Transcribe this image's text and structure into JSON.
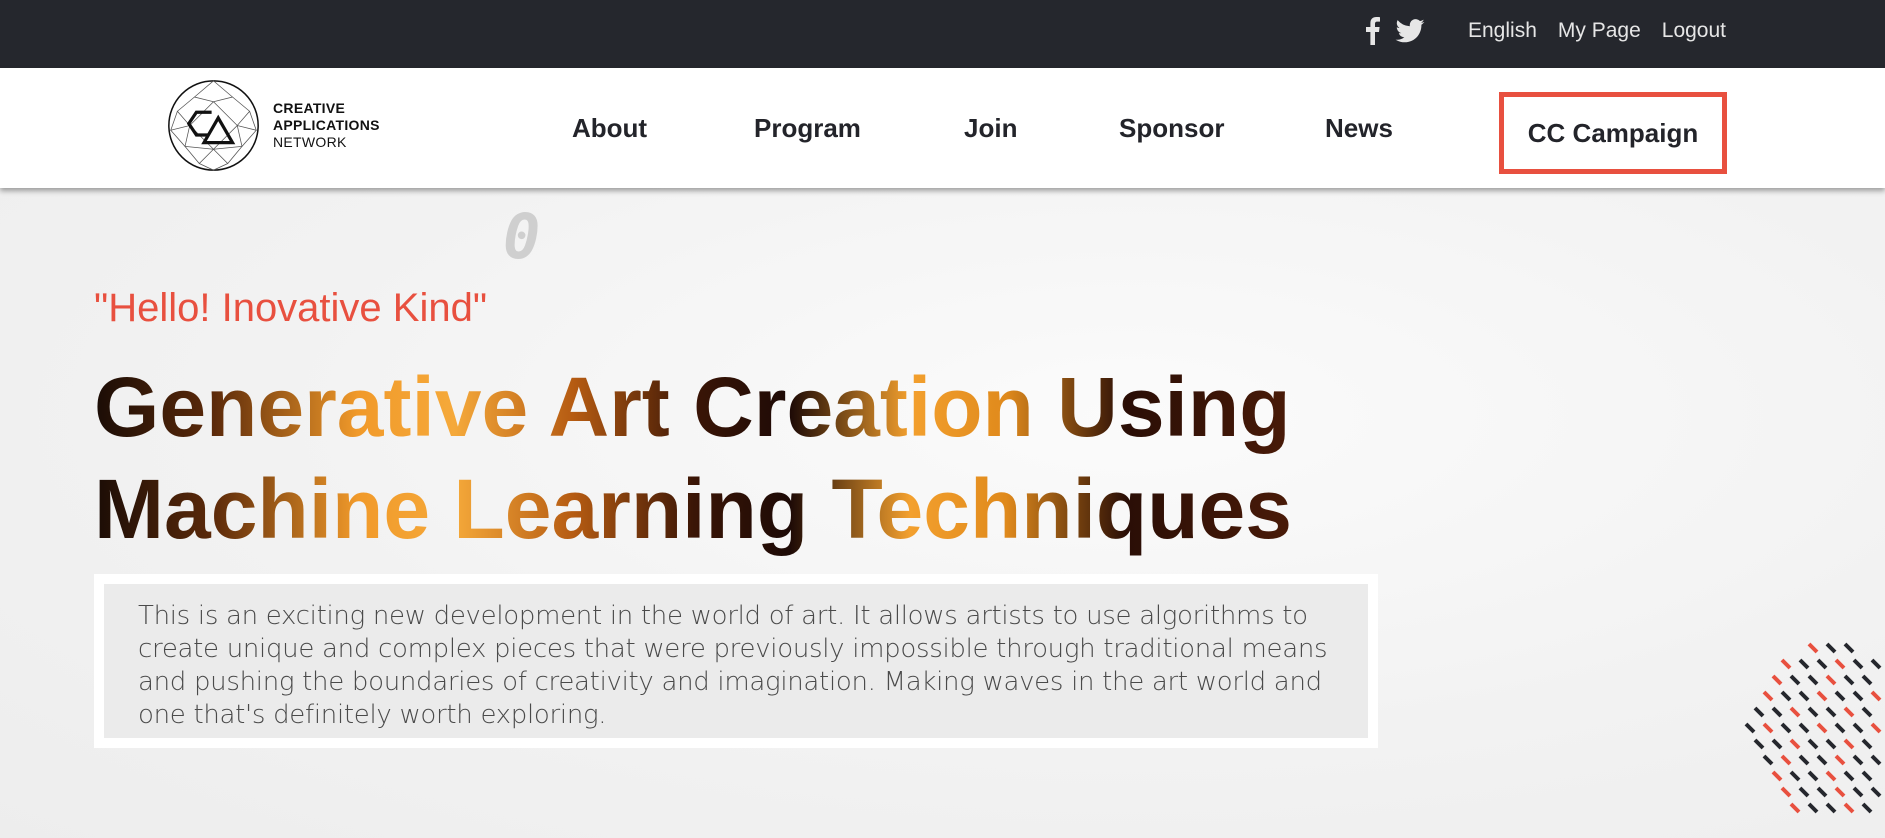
{
  "topbar": {
    "social": [
      {
        "icon": "facebook-icon"
      },
      {
        "icon": "twitter-icon"
      }
    ],
    "links": [
      "English",
      "My Page",
      "Logout"
    ]
  },
  "logo": {
    "line1": "CREATIVE",
    "line2": "APPLICATIONS",
    "line3": "NETWORK"
  },
  "nav": {
    "items": [
      "About",
      "Program",
      "Join",
      "Sponsor",
      "News"
    ],
    "cta": "CC Campaign"
  },
  "hero": {
    "greeting": "\"Hello! Inovative Kind\"",
    "headline": "Generative Art Creation Using Machine Learning Techniques",
    "description": "This is an exciting new development in the world of art. It allows artists to use algorithms to create unique and complex pieces that were previously impossible through traditional means and pushing the boundaries of creativity and imagination. Making waves in the art world and one that's definitely worth exploring.",
    "deco_glyph": "0"
  },
  "colors": {
    "accent": "#e8503f",
    "topbar": "#25272d",
    "nav_text": "#23242a"
  }
}
